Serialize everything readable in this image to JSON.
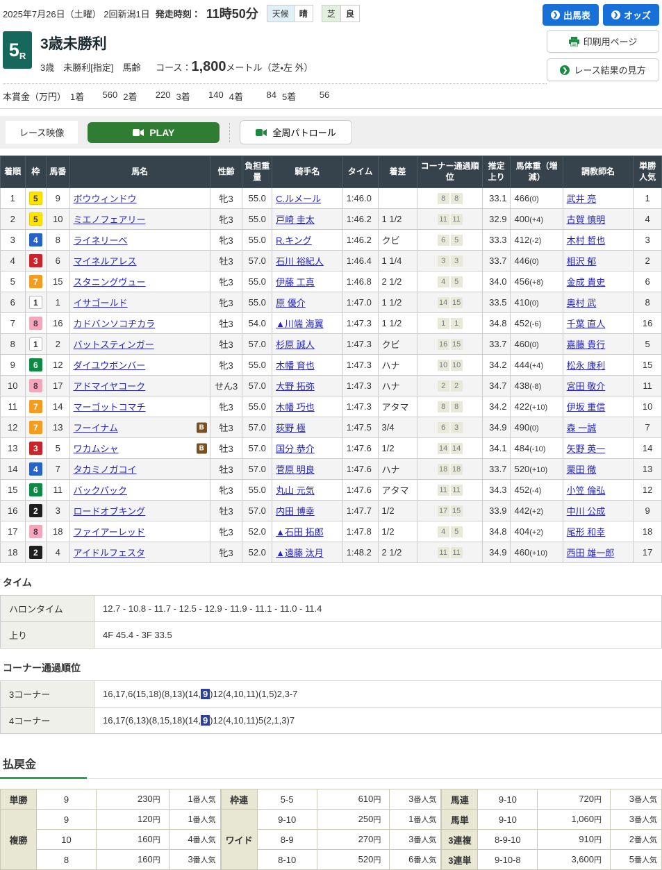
{
  "colors": {
    "accent_blue": "#1670d8",
    "table_header_bg": "#36434c",
    "play_green": "#2f7d32",
    "payout_green": "#2ca04a",
    "link_blue": "#2626c9",
    "highlight_blue": "#2c3f9e",
    "badge_green": "#17685c"
  },
  "topbar": {
    "date_line": "2025年7月26日（土曜）  2回新潟1日",
    "start_label": "発走時刻：",
    "start_time": "11時50分",
    "weather_label": "天候",
    "weather_value": "晴",
    "turf_label": "芝",
    "turf_value": "良",
    "btn_entries": "出馬表",
    "btn_odds": "オッズ",
    "btn_print": "印刷用ページ",
    "btn_guide": "レース結果の見方"
  },
  "race": {
    "number": "5",
    "number_suffix": "R",
    "title": "3歳未勝利",
    "conditions": "3歳　未勝利[指定]　馬齢",
    "course_label": "コース：",
    "course_distance": "1,800",
    "course_unit": "メートル（芝・左 外）",
    "prize_label": "本賞金（万円）",
    "prizes": [
      {
        "label": "1着",
        "value": "560"
      },
      {
        "label": "2着",
        "value": "220"
      },
      {
        "label": "3着",
        "value": "140"
      },
      {
        "label": "4着",
        "value": "84"
      },
      {
        "label": "5着",
        "value": "56"
      }
    ]
  },
  "video": {
    "label": "レース映像",
    "play_label": "PLAY",
    "patrol_label": "全周パトロール"
  },
  "results": {
    "columns": [
      "着順",
      "枠",
      "馬番",
      "馬名",
      "性齢",
      "負担重量",
      "騎手名",
      "タイム",
      "着差",
      "コーナー通過順位",
      "推定上り",
      "馬体重（増減）",
      "調教師名",
      "単勝人気"
    ],
    "waku_colors": {
      "1": {
        "bg": "#ffffff",
        "fg": "#333333",
        "border": "#bbbbbb"
      },
      "2": {
        "bg": "#1e1e1e",
        "fg": "#ffffff",
        "border": "#1e1e1e"
      },
      "3": {
        "bg": "#c9242c",
        "fg": "#ffffff",
        "border": "#c9242c"
      },
      "4": {
        "bg": "#2762c7",
        "fg": "#ffffff",
        "border": "#2762c7"
      },
      "5": {
        "bg": "#ffe400",
        "fg": "#333333",
        "border": "#e6cd00"
      },
      "6": {
        "bg": "#0e8a44",
        "fg": "#ffffff",
        "border": "#0e8a44"
      },
      "7": {
        "bg": "#f39c1f",
        "fg": "#ffffff",
        "border": "#f39c1f"
      },
      "8": {
        "bg": "#f2a7bb",
        "fg": "#553344",
        "border": "#f2a7bb"
      }
    },
    "rows": [
      {
        "pos": "1",
        "waku": "5",
        "num": "9",
        "horse": "ボウウィンドウ",
        "blinker": false,
        "sexage": "牝3",
        "weight": "55.0",
        "jockey": "C.ルメール",
        "time": "1:46.0",
        "margin": "",
        "corners": [
          "8",
          "8"
        ],
        "last3f": "33.1",
        "hweight": "466",
        "hdiff": "(0)",
        "trainer": "武井 亮",
        "pop": "1"
      },
      {
        "pos": "2",
        "waku": "5",
        "num": "10",
        "horse": "ミエノフェアリー",
        "blinker": false,
        "sexage": "牝3",
        "weight": "55.0",
        "jockey": "戸崎 圭太",
        "time": "1:46.2",
        "margin": "1 1/2",
        "corners": [
          "11",
          "11"
        ],
        "last3f": "32.9",
        "hweight": "400",
        "hdiff": "(+4)",
        "trainer": "古賀 慎明",
        "pop": "4"
      },
      {
        "pos": "3",
        "waku": "4",
        "num": "8",
        "horse": "ライネリーベ",
        "blinker": false,
        "sexage": "牝3",
        "weight": "55.0",
        "jockey": "R.キング",
        "time": "1:46.2",
        "margin": "クビ",
        "corners": [
          "6",
          "5"
        ],
        "last3f": "33.3",
        "hweight": "412",
        "hdiff": "(-2)",
        "trainer": "木村 哲也",
        "pop": "3"
      },
      {
        "pos": "4",
        "waku": "3",
        "num": "6",
        "horse": "マイネルアレス",
        "blinker": false,
        "sexage": "牡3",
        "weight": "57.0",
        "jockey": "石川 裕紀人",
        "time": "1:46.4",
        "margin": "1 1/4",
        "corners": [
          "3",
          "3"
        ],
        "last3f": "33.7",
        "hweight": "446",
        "hdiff": "(0)",
        "trainer": "相沢 郁",
        "pop": "2"
      },
      {
        "pos": "5",
        "waku": "7",
        "num": "15",
        "horse": "スタニングヴュー",
        "blinker": false,
        "sexage": "牝3",
        "weight": "55.0",
        "jockey": "伊藤 工真",
        "time": "1:46.8",
        "margin": "2 1/2",
        "corners": [
          "4",
          "5"
        ],
        "last3f": "34.0",
        "hweight": "456",
        "hdiff": "(+8)",
        "trainer": "金成 貴史",
        "pop": "6"
      },
      {
        "pos": "6",
        "waku": "1",
        "num": "1",
        "horse": "イサゴールド",
        "blinker": false,
        "sexage": "牝3",
        "weight": "55.0",
        "jockey": "原 優介",
        "time": "1:47.0",
        "margin": "1 1/2",
        "corners": [
          "14",
          "15"
        ],
        "last3f": "33.5",
        "hweight": "410",
        "hdiff": "(0)",
        "trainer": "奥村 武",
        "pop": "8"
      },
      {
        "pos": "7",
        "waku": "8",
        "num": "16",
        "horse": "カドバンソコヂカラ",
        "blinker": false,
        "sexage": "牡3",
        "weight": "54.0",
        "jockey": "▲川端 海翼",
        "time": "1:47.3",
        "margin": "1 1/2",
        "corners": [
          "1",
          "1"
        ],
        "last3f": "34.8",
        "hweight": "452",
        "hdiff": "(-6)",
        "trainer": "千葉 直人",
        "pop": "16"
      },
      {
        "pos": "8",
        "waku": "1",
        "num": "2",
        "horse": "バットスティンガー",
        "blinker": false,
        "sexage": "牡3",
        "weight": "57.0",
        "jockey": "杉原 誠人",
        "time": "1:47.3",
        "margin": "クビ",
        "corners": [
          "16",
          "15"
        ],
        "last3f": "33.7",
        "hweight": "460",
        "hdiff": "(0)",
        "trainer": "嘉藤 貴行",
        "pop": "5"
      },
      {
        "pos": "9",
        "waku": "6",
        "num": "12",
        "horse": "ダイユウボンバー",
        "blinker": false,
        "sexage": "牝3",
        "weight": "55.0",
        "jockey": "木幡 育也",
        "time": "1:47.3",
        "margin": "ハナ",
        "corners": [
          "10",
          "10"
        ],
        "last3f": "34.2",
        "hweight": "444",
        "hdiff": "(+4)",
        "trainer": "松永 康利",
        "pop": "15"
      },
      {
        "pos": "10",
        "waku": "8",
        "num": "17",
        "horse": "アドマイヤコーク",
        "blinker": false,
        "sexage": "せん3",
        "weight": "57.0",
        "jockey": "大野 拓弥",
        "time": "1:47.3",
        "margin": "ハナ",
        "corners": [
          "2",
          "2"
        ],
        "last3f": "34.7",
        "hweight": "438",
        "hdiff": "(-8)",
        "trainer": "宮田 敬介",
        "pop": "11"
      },
      {
        "pos": "11",
        "waku": "7",
        "num": "14",
        "horse": "マーゴットコマチ",
        "blinker": false,
        "sexage": "牝3",
        "weight": "55.0",
        "jockey": "木幡 巧也",
        "time": "1:47.3",
        "margin": "アタマ",
        "corners": [
          "8",
          "8"
        ],
        "last3f": "34.2",
        "hweight": "422",
        "hdiff": "(+10)",
        "trainer": "伊坂 重信",
        "pop": "10"
      },
      {
        "pos": "12",
        "waku": "7",
        "num": "13",
        "horse": "フーイナム",
        "blinker": true,
        "sexage": "牡3",
        "weight": "57.0",
        "jockey": "荻野 極",
        "time": "1:47.5",
        "margin": "3/4",
        "corners": [
          "6",
          "3"
        ],
        "last3f": "34.9",
        "hweight": "490",
        "hdiff": "(0)",
        "trainer": "森 一誠",
        "pop": "7"
      },
      {
        "pos": "13",
        "waku": "3",
        "num": "5",
        "horse": "ワカムシャ",
        "blinker": true,
        "sexage": "牡3",
        "weight": "57.0",
        "jockey": "国分 恭介",
        "time": "1:47.6",
        "margin": "1/2",
        "corners": [
          "14",
          "14"
        ],
        "last3f": "34.1",
        "hweight": "484",
        "hdiff": "(-10)",
        "trainer": "矢野 英一",
        "pop": "14"
      },
      {
        "pos": "14",
        "waku": "4",
        "num": "7",
        "horse": "タカミノガコイ",
        "blinker": false,
        "sexage": "牡3",
        "weight": "57.0",
        "jockey": "菅原 明良",
        "time": "1:47.6",
        "margin": "ハナ",
        "corners": [
          "18",
          "18"
        ],
        "last3f": "33.7",
        "hweight": "520",
        "hdiff": "(+10)",
        "trainer": "栗田 徹",
        "pop": "13"
      },
      {
        "pos": "15",
        "waku": "6",
        "num": "11",
        "horse": "バックパック",
        "blinker": false,
        "sexage": "牝3",
        "weight": "55.0",
        "jockey": "丸山 元気",
        "time": "1:47.6",
        "margin": "アタマ",
        "corners": [
          "11",
          "11"
        ],
        "last3f": "34.3",
        "hweight": "452",
        "hdiff": "(-4)",
        "trainer": "小笠 倫弘",
        "pop": "12"
      },
      {
        "pos": "16",
        "waku": "2",
        "num": "3",
        "horse": "ロードオブキング",
        "blinker": false,
        "sexage": "牡3",
        "weight": "57.0",
        "jockey": "内田 博幸",
        "time": "1:47.7",
        "margin": "1/2",
        "corners": [
          "17",
          "15"
        ],
        "last3f": "33.9",
        "hweight": "442",
        "hdiff": "(+2)",
        "trainer": "中川 公成",
        "pop": "9"
      },
      {
        "pos": "17",
        "waku": "8",
        "num": "18",
        "horse": "ファイアーレッド",
        "blinker": false,
        "sexage": "牝3",
        "weight": "52.0",
        "jockey": "▲石田 拓郎",
        "time": "1:47.8",
        "margin": "1/2",
        "corners": [
          "4",
          "5"
        ],
        "last3f": "34.8",
        "hweight": "404",
        "hdiff": "(+2)",
        "trainer": "尾形 和幸",
        "pop": "18"
      },
      {
        "pos": "18",
        "waku": "2",
        "num": "4",
        "horse": "アイドルフェスタ",
        "blinker": false,
        "sexage": "牝3",
        "weight": "52.0",
        "jockey": "▲遠藤 汰月",
        "time": "1:48.2",
        "margin": "2 1/2",
        "corners": [
          "11",
          "11"
        ],
        "last3f": "34.9",
        "hweight": "460",
        "hdiff": "(+10)",
        "trainer": "西田 雄一郎",
        "pop": "17"
      }
    ]
  },
  "time_section": {
    "title": "タイム",
    "rows": [
      {
        "label": "ハロンタイム",
        "value": "12.7 - 10.8 - 11.7 - 12.5 - 12.9 - 11.9 - 11.1 - 11.0 - 11.4"
      },
      {
        "label": "上り",
        "value": "4F 45.4 - 3F 33.5"
      }
    ]
  },
  "corner_section": {
    "title": "コーナー通過順位",
    "rows": [
      {
        "label": "3コーナー",
        "pre": "16,17,6(15,18)(8,13)(14,",
        "highlight": "9",
        "post": ")12(4,10,11)(1,5)2,3-7"
      },
      {
        "label": "4コーナー",
        "pre": "16,17(6,13)(8,15,18)(14,",
        "highlight": "9",
        "post": ")12(4,10,11)5(2,1,3)7"
      }
    ]
  },
  "payout": {
    "title": "払戻金",
    "groups": [
      [
        {
          "label": "単勝",
          "rows": [
            {
              "combo": "9",
              "amount": "230",
              "amount_unit": "円",
              "pop": "1",
              "pop_suffix": "番人気"
            }
          ]
        },
        {
          "label": "複勝",
          "rows": [
            {
              "combo": "9",
              "amount": "120",
              "amount_unit": "円",
              "pop": "1",
              "pop_suffix": "番人気"
            },
            {
              "combo": "10",
              "amount": "160",
              "amount_unit": "円",
              "pop": "4",
              "pop_suffix": "番人気"
            },
            {
              "combo": "8",
              "amount": "160",
              "amount_unit": "円",
              "pop": "3",
              "pop_suffix": "番人気"
            }
          ]
        }
      ],
      [
        {
          "label": "枠連",
          "rows": [
            {
              "combo": "5-5",
              "amount": "610",
              "amount_unit": "円",
              "pop": "3",
              "pop_suffix": "番人気"
            }
          ]
        },
        {
          "label": "ワイド",
          "rows": [
            {
              "combo": "9-10",
              "amount": "250",
              "amount_unit": "円",
              "pop": "1",
              "pop_suffix": "番人気"
            },
            {
              "combo": "8-9",
              "amount": "270",
              "amount_unit": "円",
              "pop": "3",
              "pop_suffix": "番人気"
            },
            {
              "combo": "8-10",
              "amount": "520",
              "amount_unit": "円",
              "pop": "6",
              "pop_suffix": "番人気"
            }
          ]
        }
      ],
      [
        {
          "label": "馬連",
          "rows": [
            {
              "combo": "9-10",
              "amount": "720",
              "amount_unit": "円",
              "pop": "3",
              "pop_suffix": "番人気"
            }
          ]
        },
        {
          "label": "馬単",
          "rows": [
            {
              "combo": "9-10",
              "amount": "1,060",
              "amount_unit": "円",
              "pop": "3",
              "pop_suffix": "番人気"
            }
          ]
        },
        {
          "label": "3連複",
          "rows": [
            {
              "combo": "8-9-10",
              "amount": "910",
              "amount_unit": "円",
              "pop": "2",
              "pop_suffix": "番人気"
            }
          ]
        },
        {
          "label": "3連単",
          "rows": [
            {
              "combo": "9-10-8",
              "amount": "3,600",
              "amount_unit": "円",
              "pop": "5",
              "pop_suffix": "番人気"
            }
          ]
        }
      ]
    ]
  }
}
